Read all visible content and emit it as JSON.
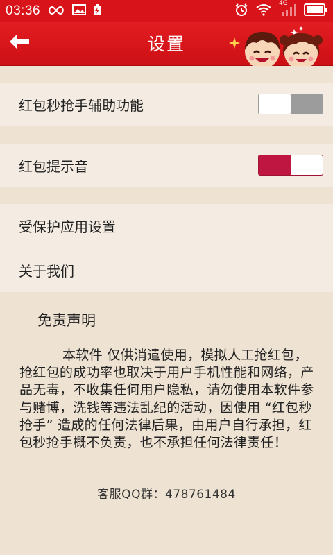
{
  "status_bar": {
    "time": "03:36",
    "left_icons": [
      "infinity-icon",
      "image-icon",
      "battery-charging-icon"
    ],
    "right_icons": [
      "alarm-icon",
      "wifi-icon",
      "signal-4g-icon",
      "battery-icon"
    ],
    "network_label": "4G"
  },
  "header": {
    "title": "设置",
    "back_icon": "arrow-left-icon",
    "mascot": "couple-mascot-image"
  },
  "settings": {
    "assist_label": "红包秒抢手辅助功能",
    "assist_enabled": false,
    "sound_label": "红包提示音",
    "sound_enabled": true,
    "protected_apps_label": "受保护应用设置",
    "about_label": "关于我们"
  },
  "disclaimer": {
    "title": "免责声明",
    "body": "本软件 仅供消遣使用，模拟人工抢红包，抢红包的成功率也取决于用户手机性能和网络，产品无毒，不收集任何用户隐私，请勿使用本软件参与赌博，洗钱等违法乱纪的活动，因使用 “红包秒抢手” 造成的任何法律后果，由用户自行承担，红包秒抢手概不负责，也不承担任何法律责任！",
    "qq_group": "客服QQ群：478761484"
  },
  "colors": {
    "brand_red": "#d8141a",
    "toggle_on": "#be1640",
    "toggle_off": "#9c9c9c",
    "background": "#eee2d2",
    "row_background": "#f4ece2"
  }
}
